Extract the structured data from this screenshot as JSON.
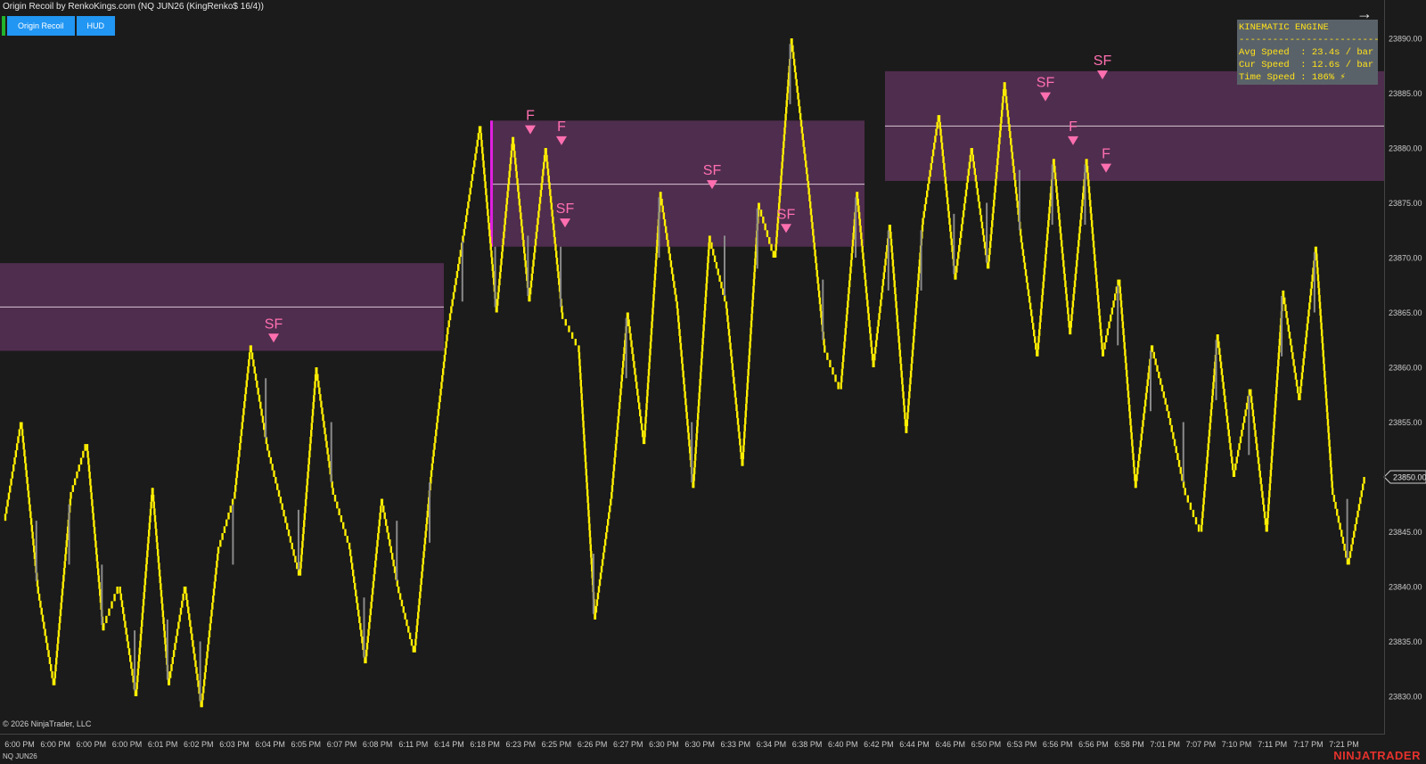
{
  "title": "Origin Recoil by RenkoKings.com (NQ JUN26 (KingRenko$ 16/4))",
  "buttons": {
    "origin_recoil": "Origin Recoil",
    "hud": "HUD"
  },
  "hud_panel": {
    "heading": "KINEMATIC ENGINE",
    "separator": "---------------------------",
    "avg_speed": "Avg Speed  : 23.4s / bar",
    "cur_speed": "Cur Speed  : 12.6s / bar",
    "time_speed": "Time Speed : 186% ⚡"
  },
  "copyright": "© 2026 NinjaTrader, LLC",
  "instrument": "NQ JUN26",
  "brand": "NINJATRADER",
  "current_price_label": "23850.00",
  "colors": {
    "background": "#1b1b1b",
    "up_bar": "#ffee00",
    "down_bar": "#8a8a8a",
    "zone": "#7a3d78",
    "signal": "#ff6fb0",
    "magenta": "#e020e0",
    "brand": "#e5322d"
  },
  "chart_data": {
    "type": "candlestick-renko",
    "y_tick_labels": [
      "23890.00",
      "23885.00",
      "23880.00",
      "23875.00",
      "23870.00",
      "23865.00",
      "23860.00",
      "23855.00",
      "23850.00",
      "23845.00",
      "23840.00",
      "23835.00",
      "23830.00"
    ],
    "y_ticks": [
      23890,
      23885,
      23880,
      23875,
      23870,
      23865,
      23860,
      23855,
      23850,
      23845,
      23840,
      23835,
      23830
    ],
    "x_tick_labels": [
      "6:00 PM",
      "6:00 PM",
      "6:00 PM",
      "6:00 PM",
      "6:01 PM",
      "6:02 PM",
      "6:03 PM",
      "6:04 PM",
      "6:05 PM",
      "6:07 PM",
      "6:08 PM",
      "6:11 PM",
      "6:14 PM",
      "6:18 PM",
      "6:23 PM",
      "6:25 PM",
      "6:26 PM",
      "6:27 PM",
      "6:30 PM",
      "6:30 PM",
      "6:33 PM",
      "6:34 PM",
      "6:38 PM",
      "6:40 PM",
      "6:42 PM",
      "6:44 PM",
      "6:46 PM",
      "6:50 PM",
      "6:53 PM",
      "6:56 PM",
      "6:56 PM",
      "6:58 PM",
      "7:01 PM",
      "7:07 PM",
      "7:10 PM",
      "7:11 PM",
      "7:17 PM",
      "7:21 PM"
    ],
    "price_path": [
      23846,
      23855,
      23840,
      23831,
      23848,
      23853,
      23836,
      23840,
      23830,
      23849,
      23831,
      23840,
      23829,
      23843,
      23848,
      23862,
      23853,
      23847,
      23841,
      23860,
      23849,
      23844,
      23833,
      23848,
      23840,
      23834,
      23850,
      23863,
      23872,
      23882,
      23865,
      23881,
      23866,
      23880,
      23865,
      23862,
      23837,
      23848,
      23865,
      23853,
      23876,
      23866,
      23849,
      23872,
      23866,
      23851,
      23875,
      23870,
      23890,
      23877,
      23862,
      23858,
      23876,
      23860,
      23873,
      23854,
      23873,
      23883,
      23868,
      23880,
      23869,
      23886,
      23872,
      23861,
      23879,
      23863,
      23879,
      23861,
      23868,
      23849,
      23862,
      23856,
      23849,
      23845,
      23863,
      23850,
      23858,
      23845,
      23867,
      23857,
      23871,
      23849,
      23842,
      23850
    ],
    "zones": [
      {
        "from": 23869.5,
        "to": 23861.5,
        "mid": 23865.5
      },
      {
        "from": 23882.5,
        "to": 23871.0,
        "mid": 23876.7
      },
      {
        "from": 23887.0,
        "to": 23877.0,
        "mid": 23882.0
      }
    ],
    "signals": [
      {
        "label": "SF",
        "price": 23862.5
      },
      {
        "label": "F",
        "price": 23881.5
      },
      {
        "label": "F",
        "price": 23880.5
      },
      {
        "label": "SF",
        "price": 23873.0
      },
      {
        "label": "SF",
        "price": 23876.5
      },
      {
        "label": "SF",
        "price": 23872.5
      },
      {
        "label": "SF",
        "price": 23884.5
      },
      {
        "label": "F",
        "price": 23880.5
      },
      {
        "label": "SF",
        "price": 23886.5
      },
      {
        "label": "F",
        "price": 23878.0
      }
    ],
    "ylim": [
      23826.5,
      23893.5
    ]
  }
}
